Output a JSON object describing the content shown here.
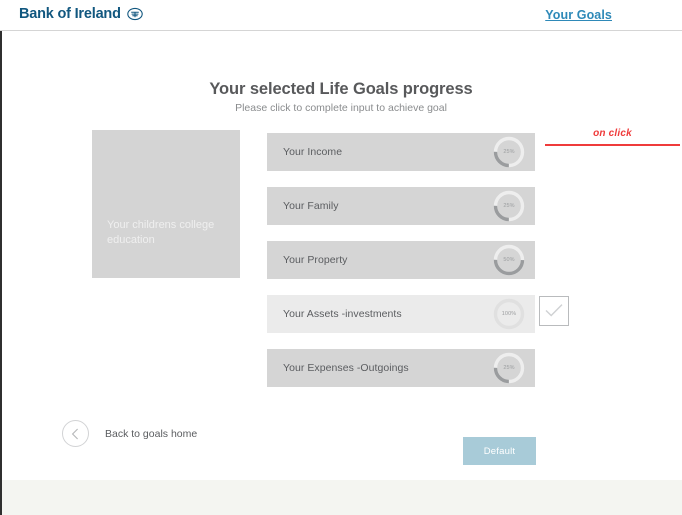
{
  "header": {
    "brand_name": "Bank of Ireland",
    "brand_mark_icon": "bank-of-ireland-emblem-icon",
    "nav_link": "Your Goals",
    "link_color": "#2e89b8"
  },
  "page": {
    "title": "Your selected Life Goals progress",
    "subtitle": "Please click to complete input to achieve goal"
  },
  "goal_panel": {
    "label": "Your childrens college education",
    "background_color": "#d4d4d4"
  },
  "rows": [
    {
      "label": "Your Income",
      "progress": 25,
      "progress_text": "25%",
      "completed": false,
      "dial_icon": "progress-dial-icon"
    },
    {
      "label": "Your Family",
      "progress": 25,
      "progress_text": "25%",
      "completed": false,
      "dial_icon": "progress-dial-icon"
    },
    {
      "label": "Your Property",
      "progress": 50,
      "progress_text": "50%",
      "completed": false,
      "dial_icon": "progress-dial-icon"
    },
    {
      "label": "Your Assets -investments",
      "progress": 100,
      "progress_text": "100%",
      "completed": true,
      "dial_icon": "progress-dial-icon",
      "check_icon": "checkmark-icon"
    },
    {
      "label": "Your Expenses -Outgoings",
      "progress": 25,
      "progress_text": "25%",
      "completed": false,
      "dial_icon": "progress-dial-icon"
    }
  ],
  "annotation": {
    "text": "on click",
    "color": "#ef3b3b"
  },
  "back": {
    "label": "Back to goals home",
    "icon": "chevron-left-icon"
  },
  "default_button": {
    "label": "Default",
    "color": "#a8cbd8"
  }
}
